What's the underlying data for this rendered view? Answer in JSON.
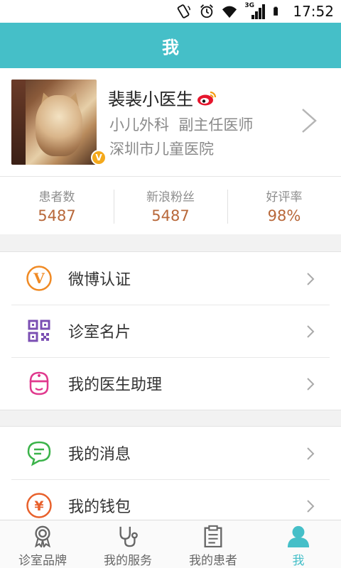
{
  "status_bar": {
    "time": "17:52",
    "network": "3G"
  },
  "header": {
    "title": "我"
  },
  "profile": {
    "name": "裴裴小医生",
    "department": "小儿外科",
    "position": "副主任医师",
    "hospital": "深圳市儿童医院",
    "badge": "V"
  },
  "stats": [
    {
      "label": "患者数",
      "value": "5487"
    },
    {
      "label": "新浪粉丝",
      "value": "5487"
    },
    {
      "label": "好评率",
      "value": "98%"
    }
  ],
  "menu_group1": [
    {
      "label": "微博认证",
      "icon": "weibo-verify-icon",
      "color": "#f08a24"
    },
    {
      "label": "诊室名片",
      "icon": "qr-code-icon",
      "color": "#7b4fb3"
    },
    {
      "label": "我的医生助理",
      "icon": "nurse-icon",
      "color": "#e0388d"
    }
  ],
  "menu_group2": [
    {
      "label": "我的消息",
      "icon": "message-icon",
      "color": "#3bb34a"
    },
    {
      "label": "我的钱包",
      "icon": "wallet-icon",
      "color": "#e8612c"
    }
  ],
  "tabs": [
    {
      "label": "诊室品牌",
      "icon": "award-icon",
      "active": false
    },
    {
      "label": "我的服务",
      "icon": "stethoscope-icon",
      "active": false
    },
    {
      "label": "我的患者",
      "icon": "clipboard-icon",
      "active": false
    },
    {
      "label": "我",
      "icon": "person-icon",
      "active": true
    }
  ],
  "colors": {
    "accent": "#45bfc8",
    "stat_value": "#b8683a"
  }
}
